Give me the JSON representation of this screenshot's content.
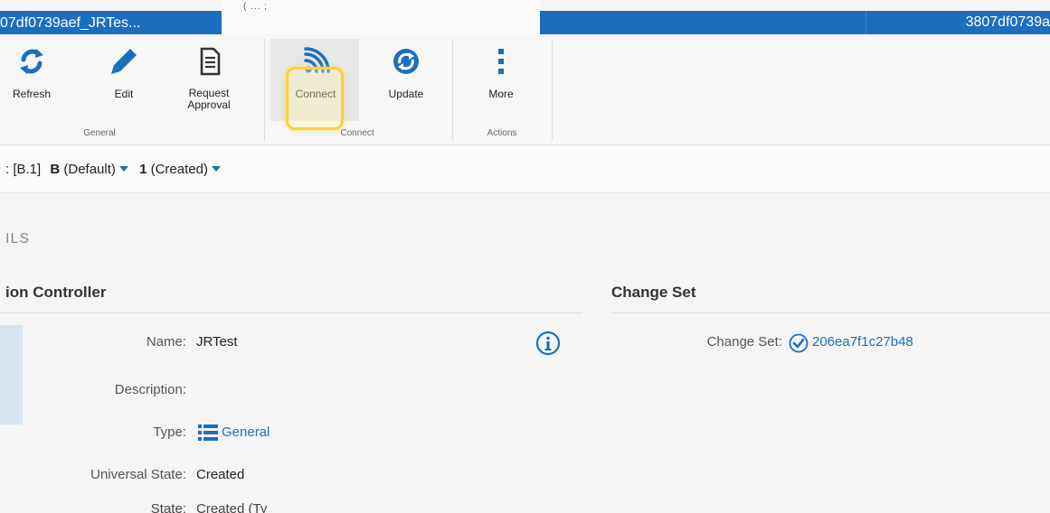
{
  "tabs": {
    "left": "07df0739aef_JRTes...",
    "active_fragment": "( ... ;",
    "right": "3807df0739a"
  },
  "ribbon": {
    "buttons": [
      {
        "label": "Refresh",
        "icon": "refresh-icon"
      },
      {
        "label": "Edit",
        "icon": "pencil-icon"
      },
      {
        "label": "Request\nApproval",
        "icon": "document-icon"
      },
      {
        "label": "Connect",
        "icon": "connect-signal-icon"
      },
      {
        "label": "Update",
        "icon": "update-sync-icon"
      },
      {
        "label": "More",
        "icon": "more-vertical-icon"
      }
    ],
    "groups": [
      "General",
      "Connect",
      "Actions"
    ]
  },
  "version": {
    "prefix": ": [B.1]",
    "branch_letter": "B",
    "branch_state": "(Default)",
    "version_number": "1",
    "version_state": "(Created)"
  },
  "details": {
    "heading": "ILS",
    "left_section_title": "ion Controller",
    "right_section_title": "Change Set",
    "name_label": "Name:",
    "name_value": "JRTest",
    "description_label": "Description:",
    "type_label": "Type:",
    "type_value": "General",
    "universal_state_label": "Universal State:",
    "universal_state_value": "Created",
    "state_label": "State:",
    "state_value": "Created (Ty",
    "change_set_label": "Change Set:",
    "change_set_value": "206ea7f1c27b48"
  },
  "colors": {
    "accent": "#1b6fbd",
    "highlight": "#f5d43a"
  }
}
